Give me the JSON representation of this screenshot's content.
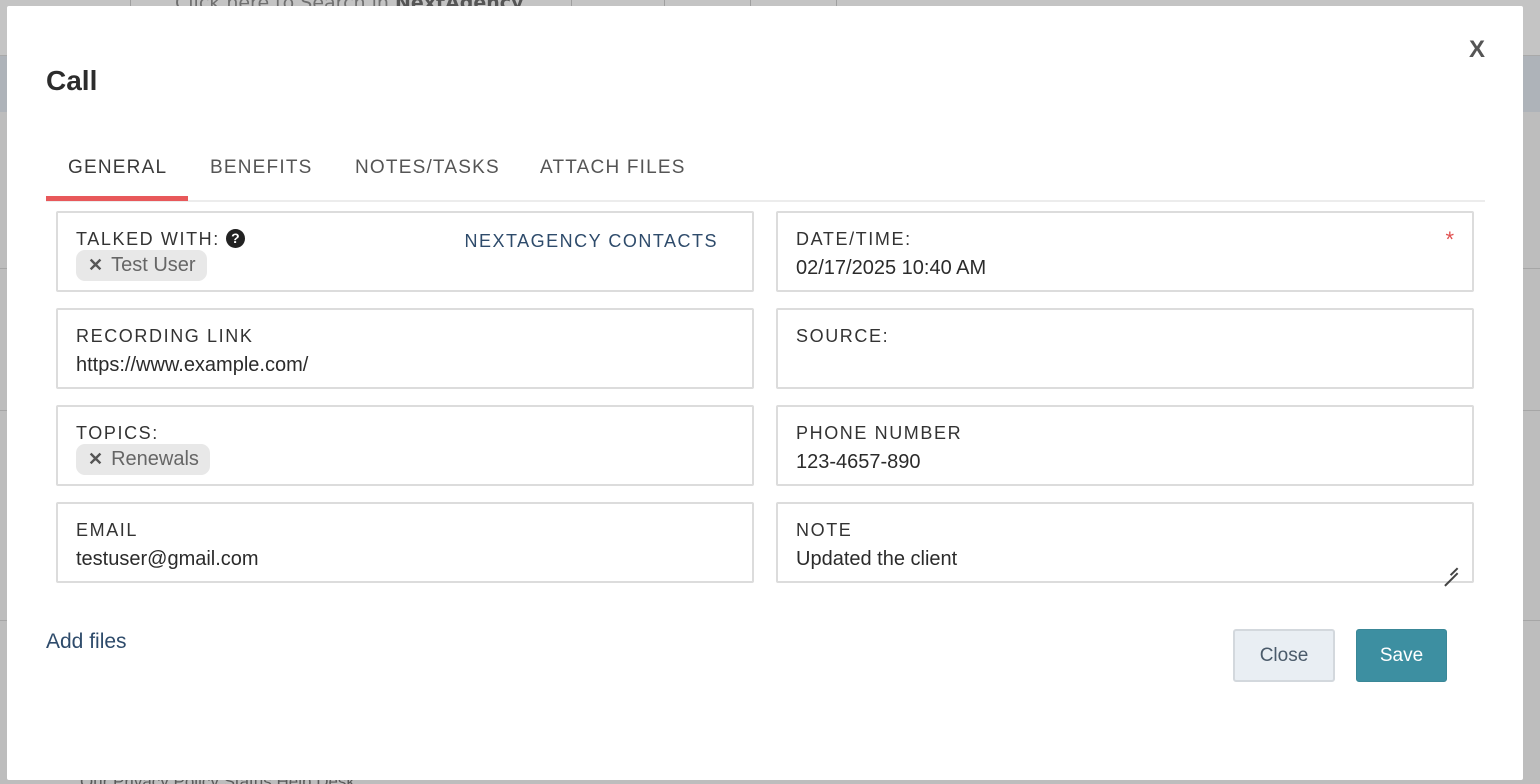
{
  "background": {
    "search_text_prefix": "Click here to Search in ",
    "search_text_brand": "NextAgency",
    "footer_text": "Our Privacy Policy   Status   Help Desk"
  },
  "modal": {
    "title": "Call",
    "close_icon_text": "X",
    "tabs": [
      {
        "label": "GENERAL",
        "active": true
      },
      {
        "label": "BENEFITS",
        "active": false
      },
      {
        "label": "NOTES/TASKS",
        "active": false
      },
      {
        "label": "ATTACH FILES",
        "active": false
      }
    ],
    "fields": {
      "talked_with": {
        "label": "TALKED WITH:",
        "help_icon": "?",
        "contacts_link": "NEXTAGENCY CONTACTS",
        "chips": [
          "Test User"
        ]
      },
      "datetime": {
        "label": "DATE/TIME:",
        "value": "02/17/2025 10:40 AM",
        "required_mark": "*"
      },
      "recording_link": {
        "label": "RECORDING LINK",
        "value": "https://www.example.com/"
      },
      "source": {
        "label": "SOURCE:",
        "value": ""
      },
      "topics": {
        "label": "TOPICS:",
        "chips": [
          "Renewals"
        ]
      },
      "phone_number": {
        "label": "PHONE NUMBER",
        "value": "123-4657-890"
      },
      "email": {
        "label": "EMAIL",
        "value": "testuser@gmail.com"
      },
      "note": {
        "label": "NOTE",
        "value": "Updated the client"
      }
    },
    "add_files_label": "Add files",
    "close_button_label": "Close",
    "save_button_label": "Save",
    "colors": {
      "tab_underline": "#e8585a",
      "save_button": "#3d8fa1",
      "link": "#2e4b6b",
      "required": "#e05050"
    }
  }
}
